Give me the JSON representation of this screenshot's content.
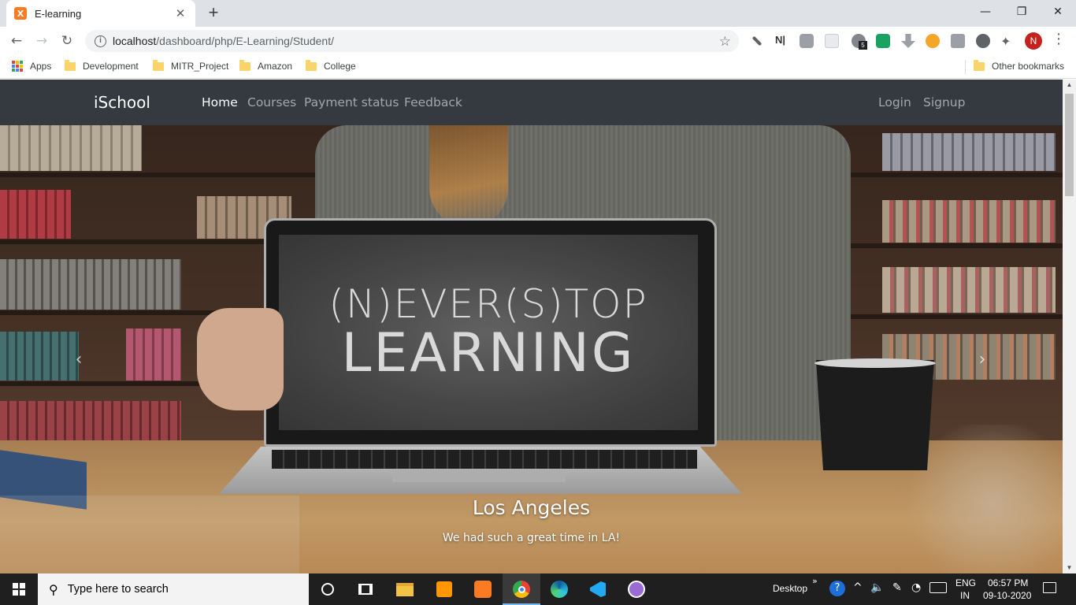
{
  "browser": {
    "tab_title": "E-learning",
    "tab_favicon_glyph": "X",
    "tab_close": "✕",
    "new_tab": "+",
    "window_controls": {
      "minimize": "—",
      "restore": "❐",
      "close": "✕"
    },
    "url_host": "localhost",
    "url_path": "/dashboard/php/E-Learning/Student/",
    "profile_initial": "N",
    "bookmarks": [
      {
        "label": "Apps",
        "icon": "apps-grid-icon"
      },
      {
        "label": "Development",
        "icon": "folder-icon"
      },
      {
        "label": "MITR_Project",
        "icon": "folder-icon"
      },
      {
        "label": "Amazon",
        "icon": "folder-icon"
      },
      {
        "label": "College",
        "icon": "folder-icon"
      }
    ],
    "other_bookmarks": "Other bookmarks",
    "extension_badge": "5"
  },
  "site": {
    "brand": "iSchool",
    "nav": [
      {
        "label": "Home",
        "active": true
      },
      {
        "label": "Courses",
        "active": false
      },
      {
        "label": "Payment status",
        "active": false
      },
      {
        "label": "Feedback",
        "active": false
      }
    ],
    "auth": {
      "login": "Login",
      "signup": "Signup"
    },
    "hero": {
      "screen_line1": "(N)EVER(S)TOP",
      "screen_line2": "LEARNING",
      "caption_title": "Los Angeles",
      "caption_text": "We had such a great time in LA!",
      "prev": "‹",
      "next": "›"
    }
  },
  "taskbar": {
    "search_placeholder": "Type here to search",
    "desktop_label": "Desktop",
    "language": "ENG",
    "region": "IN",
    "time": "06:57 PM",
    "date": "09-10-2020"
  }
}
